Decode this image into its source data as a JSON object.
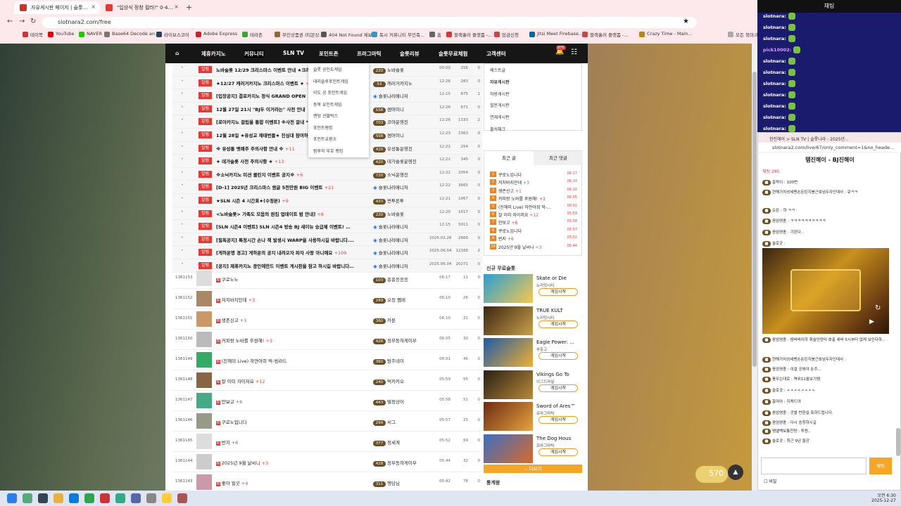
{
  "tabs": [
    {
      "label": "자유게시판 페이지 | 슬롯나라",
      "active": true
    },
    {
      "label": "\"입상식 정창 컬러!\" 0-4 중계이...",
      "active": false
    }
  ],
  "url": "slotnara2.com/free",
  "bookmarks": [
    "테이쪽",
    "YouTube",
    "NAVER",
    "Base64 Decode an...",
    "라이브스코어",
    "Adobe Express",
    "테라존",
    "무인상품권 (티몬상...",
    "404 Not Found 제보",
    "독시 커뮤니티 무인족...",
    "홈",
    "블랙홀러 플랫폼 -...",
    "임금신청",
    "Jitsi Meet Firebase...",
    "블랙홀러 플랫폼 -...",
    "Crazy Time - Main...",
    "모든 북마크"
  ],
  "nav": [
    "제휴카지노",
    "커뮤니티",
    "SLN TV",
    "포인트존",
    "프라그마틱",
    "슬롯리뷰",
    "슬롯무료체험",
    "고객센터"
  ],
  "nav_badge": "870",
  "dropdown": [
    "슬롯 공인도게임",
    "대리솔루포인트게임",
    "이도 공 포인트게임",
    "동북 유인트게임",
    "랜덤 선물박스",
    "포인트랭킹",
    "포인트교환소",
    "람루의 부호 랭킹"
  ],
  "notices": [
    {
      "t": "노바슬롯 12/29 크리스마스 이벤트 안내 ★크리스마스 롤링 이벤",
      "c": "",
      "a": "노바슬롯",
      "lv": "220",
      "d": "00:00",
      "v": "256",
      "r": "0"
    },
    {
      "t": "★12/27 캐러거카지노 크리스마스 이벤트 ★",
      "c": "+1",
      "a": "캐러거카지노",
      "lv": "53",
      "d": "12:26",
      "v": "283",
      "r": "0"
    },
    {
      "t": "[입장공지] 결로카지노 정식 GRAND OPEN",
      "c": "",
      "a": "슬롯나라매니저",
      "lv": "",
      "d": "12:15",
      "v": "875",
      "r": "1"
    },
    {
      "t": "12월 27일 21시 \"BJ두 이거라는\" 사전 안내",
      "c": "",
      "a": "썸머이니",
      "lv": "SSR",
      "d": "12:26",
      "v": "671",
      "r": "0"
    },
    {
      "t": "[로아카지노 걸립을 통합 이벤트] ※사전 알내 *",
      "c": "",
      "a": "코야운영진",
      "lv": "703",
      "d": "12:26",
      "v": "1333",
      "r": "2"
    },
    {
      "t": "12월 28일 ★유성교 재태번들★ 진심대 참여하시",
      "c": "",
      "a": "썸머이니",
      "lv": "SSR",
      "d": "12:23",
      "v": "2363",
      "r": "0"
    },
    {
      "t": "※ 유성통 뱃패주 주의사항 안내 ※",
      "c": "+11",
      "a": "유성통운영진",
      "lv": "420",
      "d": "12:22",
      "v": "254",
      "r": "0"
    },
    {
      "t": "★ 데가슬롯 사전 주의사항 ★",
      "c": "+13",
      "a": "데가슬롯운영진",
      "lv": "420",
      "d": "12:22",
      "v": "345",
      "r": "0"
    },
    {
      "t": "※소닉카지노 미션 클린지 이벤트 공지※",
      "c": "+6",
      "a": "소닉운영진",
      "lv": "720",
      "d": "12:22",
      "v": "2054",
      "r": "0"
    },
    {
      "t": "[D-1] 2025년 크리스마스 쌈글 5천만원 BIG 이벤트",
      "c": "+21",
      "a": "슬롯나라매니저",
      "lv": "",
      "d": "12:22",
      "v": "3665",
      "r": "0"
    },
    {
      "t": "★SLN 시즌 4 시간표★(수정본)",
      "c": "+9",
      "a": "변투른투",
      "lv": "433",
      "d": "12:21",
      "v": "1067",
      "r": "0"
    },
    {
      "t": "<노바슬롯> 가족도 모음의 원킴 업데이트 밤 안내]",
      "c": "+8",
      "a": "노바슬롯",
      "lv": "220",
      "d": "12:20",
      "v": "1617",
      "r": "0"
    },
    {
      "t": "[SLN 시즌4 이벤트] SLN 시즌4 방송 BJ 새이뉴 승급제 이벤트!",
      "c": "+780",
      "a": "슬롯나라매니저",
      "lv": "",
      "d": "12:15",
      "v": "5011",
      "r": "0"
    },
    {
      "t": "[필독공지] 특정시간 손나 잭 발생시 WARP을 사용하시길 바랍니다.",
      "c": "+34",
      "a": "슬롯나라매니저",
      "lv": "",
      "d": "2025.02.28",
      "v": "2666",
      "r": "0"
    },
    {
      "t": "[게하운명 경고] 게하운의 공지 내려오자 파자 사랑 아니예요",
      "c": "+109",
      "a": "슬롯나라매니저",
      "lv": "",
      "d": "2025.06.04",
      "v": "12168",
      "r": "2"
    },
    {
      "t": "[공지] 제휴카지노 광인에만드 이벤트 게시판을 참고 하시길 바랍니다.",
      "c": "+22",
      "a": "슬롯나라매니저",
      "lv": "",
      "d": "2025.06.04",
      "v": "20271",
      "r": "0"
    }
  ],
  "notice_tag": "알림",
  "posts": [
    {
      "no": "1361153",
      "t": "쿠로노노",
      "c": "",
      "a": "흥흥응응응",
      "lv": "103",
      "d": "06:17",
      "v": "11",
      "r": "0"
    },
    {
      "t": "저치바지인데",
      "no": "1361152",
      "c": "+3",
      "a": "오징 쨈레",
      "lv": "249",
      "d": "06:10",
      "v": "26",
      "r": "0"
    },
    {
      "no": "1361151",
      "t": "생존신고",
      "c": "+1",
      "a": "카룬",
      "lv": "360",
      "d": "06:10",
      "v": "21",
      "r": "0"
    },
    {
      "no": "1361150",
      "t": "커피랑 노바를 후원해!",
      "c": "+3",
      "a": "정부동하게이부",
      "lv": "428",
      "d": "06:05",
      "v": "30",
      "r": "0"
    },
    {
      "no": "1361149",
      "t": "(진해미 Live) 하얀아희 딱-씽라드",
      "c": "",
      "a": "탐주네이",
      "lv": "360",
      "d": "06:01",
      "v": "46",
      "r": "0"
    },
    {
      "no": "1361148",
      "t": "잘 이미 자이저요",
      "c": "+12",
      "a": "떡카카오",
      "lv": "240",
      "d": "05:59",
      "v": "55",
      "r": "0"
    },
    {
      "no": "1361147",
      "t": "안보고",
      "c": "+6",
      "a": "텔정상어",
      "lv": "443",
      "d": "05:58",
      "v": "51",
      "r": "0"
    },
    {
      "no": "1361146",
      "t": "쿠로노입니다",
      "c": "",
      "a": "씨그",
      "lv": "299",
      "d": "05:57",
      "v": "25",
      "r": "0"
    },
    {
      "no": "1361145",
      "t": "번지",
      "c": "+6",
      "a": "정세계",
      "lv": "377",
      "d": "05:52",
      "v": "69",
      "r": "0"
    },
    {
      "no": "1361144",
      "t": "2025년 9월 날씨니",
      "c": "+3",
      "a": "정부동하게이부",
      "lv": "428",
      "d": "05:44",
      "v": "32",
      "r": "0"
    },
    {
      "no": "1361143",
      "t": "좋아 힐굿",
      "c": "+4",
      "a": "행당님",
      "lv": "311",
      "d": "05:42",
      "v": "78",
      "r": "0"
    }
  ],
  "side_links": [
    "베스트글",
    "자유게시판",
    "자랑게시판",
    "질문게시판",
    "연재게시판",
    "출석체크"
  ],
  "rank_tabs": [
    "최근 글",
    "최근 댓글"
  ],
  "ranks": [
    {
      "t": "쿠로노입니다",
      "c": "",
      "tm": "06:17"
    },
    {
      "t": "저치바지인데",
      "c": "+3",
      "tm": "06:10"
    },
    {
      "t": "생존신고",
      "c": "+1",
      "tm": "06:10"
    },
    {
      "t": "커피랑 노바를 후원해!",
      "c": "+3",
      "tm": "06:05"
    },
    {
      "t": "(진해미 Live) 하얀아희 딱-씽라드",
      "c": "",
      "tm": "06:01"
    },
    {
      "t": "잘 이미 자이저요",
      "c": "+12",
      "tm": "05:59"
    },
    {
      "t": "안보고",
      "c": "+6",
      "tm": "05:58"
    },
    {
      "t": "쿠로노입니다",
      "c": "",
      "tm": "05:57"
    },
    {
      "t": "번지",
      "c": "+6",
      "tm": "05:52"
    },
    {
      "t": "2025년 9월 날씨니",
      "c": "+3",
      "tm": "05:44"
    }
  ],
  "new_games_title": "신규 무료슬롯",
  "games": [
    {
      "n": "Skate or Die",
      "p": "노리밋시티",
      "btn": "게임시작"
    },
    {
      "n": "TRUE KULT",
      "p": "노리밋시티",
      "btn": "게임시작"
    },
    {
      "n": "Eagle Power: ...",
      "p": "부운고",
      "btn": "게임시작"
    },
    {
      "n": "Vikings Go To",
      "p": "이그드라실",
      "btn": "게임시작"
    },
    {
      "n": "Sword of Ares™",
      "p": "프라그마틱",
      "btn": "게임시작"
    },
    {
      "n": "The Dog Hous",
      "p": "프라그마틱",
      "btn": "게임시작"
    }
  ],
  "more_label": "더보기",
  "stats_label": "통계왕",
  "points": "570",
  "chat": {
    "title": "채팅",
    "msgs": [
      "slotnara:",
      "slotnara:",
      "slotnara:",
      "pick10002:",
      "slotnara:",
      "slotnara:",
      "slotnara:",
      "slotnara:",
      "slotnara:",
      "slotnara:",
      "slotnara:"
    ]
  },
  "popup": {
    "title": "한진해이 > SLN TV | 슬롯나라 - 2025년...",
    "url": "slotnara2.com/live/67/only_comment=1&no_heade...",
    "heading": "탬진해이 - BJ진해이",
    "count": "채팅 295",
    "send": "채팅",
    "tool_label": "비밀",
    "msgs": [
      "흥락이 : 100번",
      "현해가치성세벤손돈틴지봉근호넘두자인데사 : 큐ㅋㅋ",
      "오픈 : 하 ㅋㅋ",
      "음엄영종 : ㅋㅋㅋㅋㅋㅋㅋㅋㅋㅋ",
      "음엄영종 : 기린다..",
      "슬로곳 :",
      "음엄영종 : 밤바바이하 휘슬안란터 호출 세바 5시부터 없케 보인다하는..",
      "현해가치성세벤손돈틴지봉근호넘두자인데사 :",
      "음엄영종 : 이걸 굿봐야 돈주...",
      "풍무는대로 : 역위11월보기템",
      "슬로곳 : ㅅㅅㅅㅅㅅㅅㅅㅅ",
      "흥여아 : 지쳐드야",
      "음엄영종 : 굿벌 반환실 축하드립니다.",
      "음엄영종 : 다시 승정하시길",
      "탬엘백보통잔량 : 투원..",
      "슬로곳 : 최근 9년 둘강"
    ]
  },
  "clock": {
    "time": "오전 6:30",
    "date": "2025-12-27"
  }
}
